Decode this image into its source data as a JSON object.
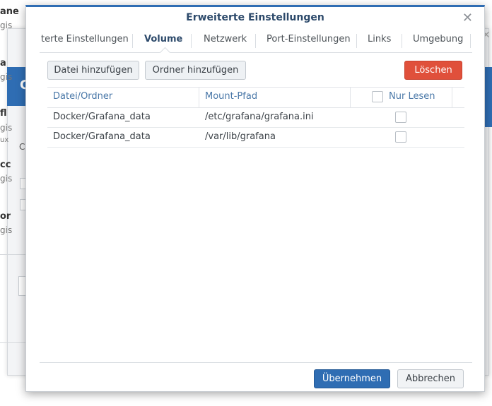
{
  "background": {
    "fragments": [
      "ane",
      "gis",
      "a",
      "gis",
      "C",
      "fl",
      "gis",
      "ux",
      "C",
      "cc",
      "gis",
      "or",
      "gis"
    ]
  },
  "dialog": {
    "title": "Erweiterte Einstellungen",
    "tabs": [
      {
        "label": "terte Einstellungen",
        "active": false
      },
      {
        "label": "Volume",
        "active": true
      },
      {
        "label": "Netzwerk",
        "active": false
      },
      {
        "label": "Port-Einstellungen",
        "active": false
      },
      {
        "label": "Links",
        "active": false
      },
      {
        "label": "Umgebung",
        "active": false
      }
    ],
    "toolbar": {
      "add_file": "Datei hinzufügen",
      "add_folder": "Ordner hinzufügen",
      "delete": "Löschen"
    },
    "table": {
      "headers": {
        "file_folder": "Datei/Ordner",
        "mount_path": "Mount-Pfad",
        "read_only": "Nur Lesen"
      },
      "rows": [
        {
          "file_folder": "Docker/Grafana_data",
          "mount_path": "/etc/grafana/grafana.ini",
          "read_only": false
        },
        {
          "file_folder": "Docker/Grafana_data",
          "mount_path": "/var/lib/grafana",
          "read_only": false
        }
      ]
    },
    "footer": {
      "apply": "Übernehmen",
      "cancel": "Abbrechen"
    }
  },
  "colors": {
    "accent": "#2f6db3",
    "danger": "#e0503b",
    "header_text": "#4a78a8"
  }
}
